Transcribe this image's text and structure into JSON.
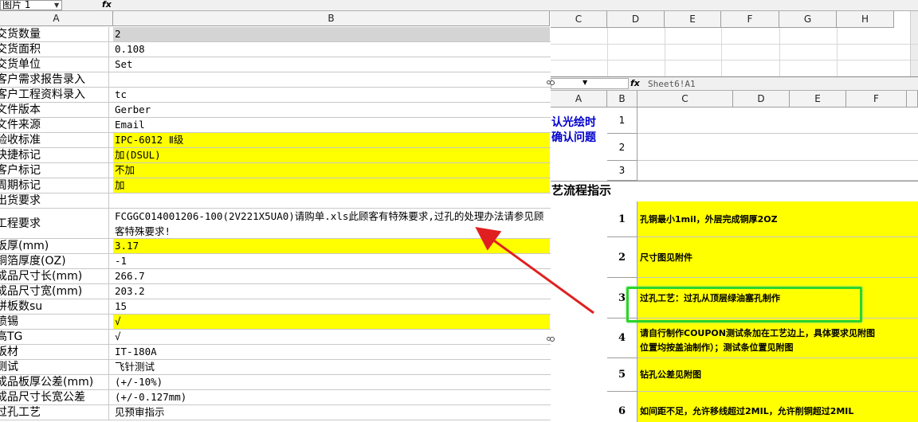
{
  "left_sheet": {
    "name_box": "图片 1",
    "fx": "fx",
    "columns": [
      "A",
      "B"
    ],
    "rows": [
      {
        "a": "交货数量",
        "b": "2",
        "yellow": false,
        "selected": true
      },
      {
        "a": "交货面积",
        "b": "0.108",
        "yellow": false
      },
      {
        "a": "交货单位",
        "b": "Set",
        "yellow": false
      },
      {
        "a": "客户需求报告录入",
        "b": "",
        "yellow": false
      },
      {
        "a": "客户工程资料录入",
        "b": "tc",
        "yellow": false
      },
      {
        "a": "文件版本",
        "b": "Gerber",
        "yellow": false
      },
      {
        "a": "文件来源",
        "b": "Email",
        "yellow": false
      },
      {
        "a": "验收标准",
        "b": "IPC-6012 Ⅱ级",
        "yellow": true
      },
      {
        "a": "快捷标记",
        "b": "加(DSUL)",
        "yellow": true
      },
      {
        "a": "客户标记",
        "b": "不加",
        "yellow": true
      },
      {
        "a": "周期标记",
        "b": "加",
        "yellow": true
      },
      {
        "a": "出货要求",
        "b": "",
        "yellow": false
      },
      {
        "a": "工程要求",
        "b": "FCGGC014001206-100(2V221X5UA0)请购单.xls此顾客有特殊要求,过孔的处理办法请参见顾客特殊要求!",
        "yellow": false,
        "tall": true
      },
      {
        "a": "板厚(mm)",
        "b": "3.17",
        "yellow": true
      },
      {
        "a": "铜箔厚度(OZ)",
        "b": "-1",
        "yellow": false
      },
      {
        "a": "成品尺寸长(mm)",
        "b": "266.7",
        "yellow": false
      },
      {
        "a": "成品尺寸宽(mm)",
        "b": "203.2",
        "yellow": false
      },
      {
        "a": "拼板数su",
        "b": "15",
        "yellow": false
      },
      {
        "a": "喷锡",
        "b": "√",
        "yellow": true
      },
      {
        "a": "高TG",
        "b": "√",
        "yellow": false
      },
      {
        "a": "板材",
        "b": "IT-180A",
        "yellow": false
      },
      {
        "a": "测试",
        "b": "飞针测试",
        "yellow": false
      },
      {
        "a": "成品板厚公差(mm)",
        "b": "(+/-10%)",
        "yellow": false
      },
      {
        "a": "成品尺寸长宽公差",
        "b": "(+/-0.127mm)",
        "yellow": false
      },
      {
        "a": "过孔工艺",
        "b": "见预审指示",
        "yellow": false
      }
    ]
  },
  "right_sheet": {
    "columns": [
      "C",
      "D",
      "E",
      "F",
      "G",
      "H"
    ]
  },
  "embedded_sheet": {
    "fx": "fx",
    "formula_text": "Sheet6!A1",
    "columns": [
      "A",
      "B",
      "C",
      "D",
      "E",
      "F"
    ],
    "confirm_label_line1": "认光绘时",
    "confirm_label_line2": "确认问题",
    "confirm_rows": [
      "1",
      "2",
      "3"
    ],
    "section_title": "艺流程指示",
    "process_rows": [
      {
        "num": "1",
        "text": "孔铜最小1mil，外层完成铜厚2OZ"
      },
      {
        "num": "2",
        "text": "尺寸图见附件"
      },
      {
        "num": "3",
        "text": "过孔工艺：过孔从顶层绿油塞孔制作"
      },
      {
        "num": "4",
        "text": "请自行制作COUPON测试条加在工艺边上，具体要求见附图",
        "text2": "位置均按盖油制作）；测试条位置见附图"
      },
      {
        "num": "5",
        "text": "钻孔公差见附图"
      },
      {
        "num": "6",
        "text": "如间距不足，允许移线超过2MIL，允许削铜超过2MIL"
      }
    ]
  },
  "annotations": {
    "arrow_color": "#e02020",
    "highlight_color": "#2bd42b"
  }
}
